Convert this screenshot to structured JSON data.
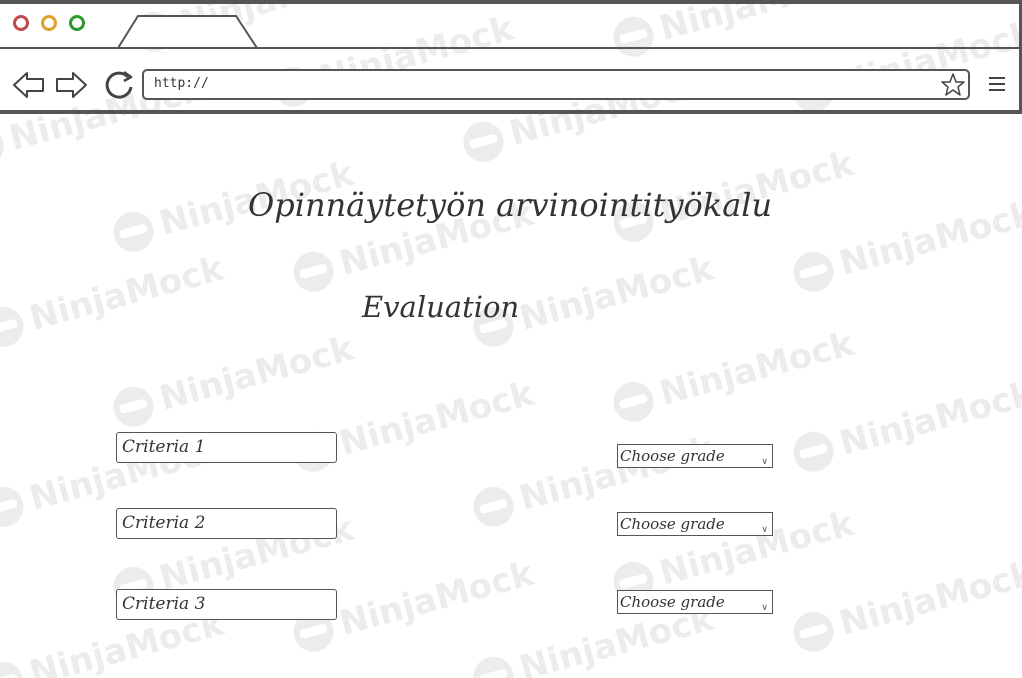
{
  "browser": {
    "url": "http://",
    "controls": {
      "close_color": "#c44a4a",
      "minimize_color": "#e0a030",
      "maximize_color": "#2a9a2a"
    },
    "icons": {
      "back": "back-arrow-icon",
      "forward": "forward-arrow-icon",
      "reload": "reload-icon",
      "bookmark": "star-icon",
      "menu": "hamburger-menu-icon"
    }
  },
  "main": {
    "title": "Opinnäytetyön arvinointityökalu",
    "subtitle": "Evaluation",
    "criteria": [
      {
        "value": "Criteria 1",
        "grade": "Choose grade"
      },
      {
        "value": "Criteria 2",
        "grade": "Choose grade"
      },
      {
        "value": "Criteria 3",
        "grade": "Choose grade"
      }
    ]
  },
  "watermark": "NinjaMock"
}
